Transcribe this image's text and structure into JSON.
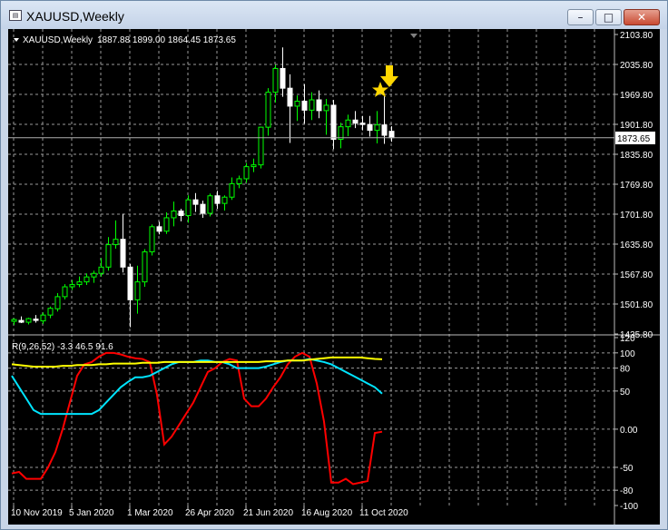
{
  "window": {
    "title": "XAUUSD,Weekly",
    "buttons": {
      "minimize": "–",
      "maximize": "□",
      "close": "✕"
    }
  },
  "chart_header": {
    "symbol": "XAUUSD,Weekly",
    "ohlc": "1887.88 1899.00 1864.45 1873.65"
  },
  "indicator_header": {
    "text": "R(9,26,52) -3.3 46.5 91.6"
  },
  "current_price": "1873.65",
  "markers": {
    "star_icon": "star-icon",
    "arrow_icon": "down-arrow-icon",
    "color": "#ffd700"
  },
  "colors": {
    "up": "#00ff00",
    "down": "#ffffff",
    "rsi_fast": "#ff0000",
    "rsi_mid": "#00e5ff",
    "rsi_slow": "#ffff00",
    "grid": "#9a9a9a"
  },
  "chart_data": [
    {
      "type": "candlestick",
      "title": "XAUUSD,Weekly",
      "y_ticks": [
        "2103.80",
        "2035.80",
        "1969.80",
        "1901.80",
        "1835.80",
        "1769.80",
        "1701.80",
        "1635.80",
        "1567.80",
        "1501.80",
        "1435.80"
      ],
      "x_ticks": [
        "10 Nov 2019",
        "5 Jan 2020",
        "1 Mar 2020",
        "26 Apr 2020",
        "21 Jun 2020",
        "16 Aug 2020",
        "11 Oct 2020"
      ],
      "ylim": [
        1435.8,
        2103.8
      ],
      "grid": true,
      "candles": [
        {
          "o": 1464,
          "h": 1471,
          "l": 1456,
          "c": 1468
        },
        {
          "o": 1466,
          "h": 1475,
          "l": 1460,
          "c": 1462
        },
        {
          "o": 1462,
          "h": 1472,
          "l": 1457,
          "c": 1470
        },
        {
          "o": 1469,
          "h": 1478,
          "l": 1461,
          "c": 1466
        },
        {
          "o": 1465,
          "h": 1484,
          "l": 1458,
          "c": 1478
        },
        {
          "o": 1478,
          "h": 1497,
          "l": 1471,
          "c": 1493
        },
        {
          "o": 1492,
          "h": 1527,
          "l": 1486,
          "c": 1519
        },
        {
          "o": 1519,
          "h": 1547,
          "l": 1513,
          "c": 1541
        },
        {
          "o": 1541,
          "h": 1556,
          "l": 1534,
          "c": 1546
        },
        {
          "o": 1546,
          "h": 1564,
          "l": 1540,
          "c": 1552
        },
        {
          "o": 1552,
          "h": 1571,
          "l": 1545,
          "c": 1563
        },
        {
          "o": 1563,
          "h": 1577,
          "l": 1550,
          "c": 1571
        },
        {
          "o": 1571,
          "h": 1605,
          "l": 1564,
          "c": 1585
        },
        {
          "o": 1585,
          "h": 1652,
          "l": 1577,
          "c": 1635
        },
        {
          "o": 1635,
          "h": 1689,
          "l": 1626,
          "c": 1647
        },
        {
          "o": 1647,
          "h": 1704,
          "l": 1573,
          "c": 1585
        },
        {
          "o": 1585,
          "h": 1592,
          "l": 1451,
          "c": 1512
        },
        {
          "o": 1512,
          "h": 1588,
          "l": 1481,
          "c": 1552
        },
        {
          "o": 1552,
          "h": 1625,
          "l": 1541,
          "c": 1619
        },
        {
          "o": 1619,
          "h": 1680,
          "l": 1611,
          "c": 1675
        },
        {
          "o": 1675,
          "h": 1686,
          "l": 1658,
          "c": 1665
        },
        {
          "o": 1665,
          "h": 1707,
          "l": 1659,
          "c": 1695
        },
        {
          "o": 1695,
          "h": 1731,
          "l": 1676,
          "c": 1710
        },
        {
          "o": 1710,
          "h": 1715,
          "l": 1687,
          "c": 1700
        },
        {
          "o": 1700,
          "h": 1745,
          "l": 1684,
          "c": 1735
        },
        {
          "o": 1735,
          "h": 1750,
          "l": 1708,
          "c": 1725
        },
        {
          "o": 1725,
          "h": 1733,
          "l": 1695,
          "c": 1705
        },
        {
          "o": 1705,
          "h": 1749,
          "l": 1698,
          "c": 1744
        },
        {
          "o": 1744,
          "h": 1755,
          "l": 1715,
          "c": 1727
        },
        {
          "o": 1727,
          "h": 1745,
          "l": 1711,
          "c": 1741
        },
        {
          "o": 1741,
          "h": 1785,
          "l": 1735,
          "c": 1771
        },
        {
          "o": 1771,
          "h": 1789,
          "l": 1761,
          "c": 1782
        },
        {
          "o": 1782,
          "h": 1817,
          "l": 1773,
          "c": 1809
        },
        {
          "o": 1809,
          "h": 1827,
          "l": 1797,
          "c": 1813
        },
        {
          "o": 1813,
          "h": 1898,
          "l": 1805,
          "c": 1897
        },
        {
          "o": 1897,
          "h": 1984,
          "l": 1878,
          "c": 1975
        },
        {
          "o": 1975,
          "h": 2036,
          "l": 1952,
          "c": 2028
        },
        {
          "o": 2028,
          "h": 2075,
          "l": 1965,
          "c": 1984
        },
        {
          "o": 1984,
          "h": 2015,
          "l": 1862,
          "c": 1944
        },
        {
          "o": 1944,
          "h": 1968,
          "l": 1911,
          "c": 1955
        },
        {
          "o": 1955,
          "h": 1993,
          "l": 1905,
          "c": 1935
        },
        {
          "o": 1935,
          "h": 1975,
          "l": 1913,
          "c": 1958
        },
        {
          "o": 1958,
          "h": 1979,
          "l": 1917,
          "c": 1934
        },
        {
          "o": 1934,
          "h": 1960,
          "l": 1880,
          "c": 1946
        },
        {
          "o": 1946,
          "h": 1958,
          "l": 1848,
          "c": 1870
        },
        {
          "o": 1870,
          "h": 1907,
          "l": 1850,
          "c": 1898
        },
        {
          "o": 1898,
          "h": 1925,
          "l": 1877,
          "c": 1913
        },
        {
          "o": 1913,
          "h": 1933,
          "l": 1895,
          "c": 1906
        },
        {
          "o": 1906,
          "h": 1922,
          "l": 1890,
          "c": 1903
        },
        {
          "o": 1903,
          "h": 1922,
          "l": 1876,
          "c": 1890
        },
        {
          "o": 1890,
          "h": 1933,
          "l": 1861,
          "c": 1902
        },
        {
          "o": 1902,
          "h": 1966,
          "l": 1860,
          "c": 1879
        },
        {
          "o": 1887.88,
          "h": 1899,
          "l": 1864.45,
          "c": 1873.65
        }
      ]
    },
    {
      "type": "line",
      "title": "R(9,26,52)",
      "y_ticks": [
        "120",
        "100",
        "80",
        "50",
        "0.00",
        "-50",
        "-80",
        "-100"
      ],
      "ylim": [
        -100,
        120
      ],
      "series": [
        {
          "name": "R(9)",
          "values": [
            -58,
            -56,
            -65,
            -65,
            -65,
            -50,
            -30,
            0,
            35,
            70,
            85,
            88,
            95,
            100,
            100,
            98,
            95,
            93,
            92,
            88,
            45,
            -20,
            -10,
            5,
            20,
            35,
            55,
            75,
            80,
            88,
            92,
            90,
            40,
            30,
            30,
            40,
            55,
            68,
            85,
            95,
            100,
            95,
            60,
            10,
            -70,
            -70,
            -65,
            -72,
            -70,
            -68,
            -5,
            -3.3
          ]
        },
        {
          "name": "R(26)",
          "values": [
            70,
            55,
            40,
            25,
            20,
            20,
            20,
            20,
            20,
            20,
            20,
            20,
            25,
            35,
            45,
            55,
            62,
            68,
            68,
            70,
            75,
            80,
            85,
            88,
            88,
            88,
            90,
            90,
            88,
            88,
            85,
            80,
            80,
            80,
            80,
            82,
            85,
            88,
            90,
            90,
            90,
            92,
            90,
            88,
            85,
            80,
            75,
            70,
            65,
            60,
            55,
            46.5
          ]
        },
        {
          "name": "R(52)",
          "values": [
            85,
            84,
            83,
            82,
            82,
            82,
            82,
            83,
            83,
            84,
            84,
            84,
            85,
            85,
            86,
            86,
            86,
            86,
            87,
            87,
            87,
            88,
            88,
            88,
            88,
            88,
            88,
            88,
            88,
            88,
            88,
            88,
            88,
            88,
            88,
            89,
            89,
            89,
            90,
            90,
            90,
            91,
            92,
            93,
            94,
            94,
            94,
            94,
            94,
            93,
            92,
            91.6
          ]
        }
      ]
    }
  ]
}
